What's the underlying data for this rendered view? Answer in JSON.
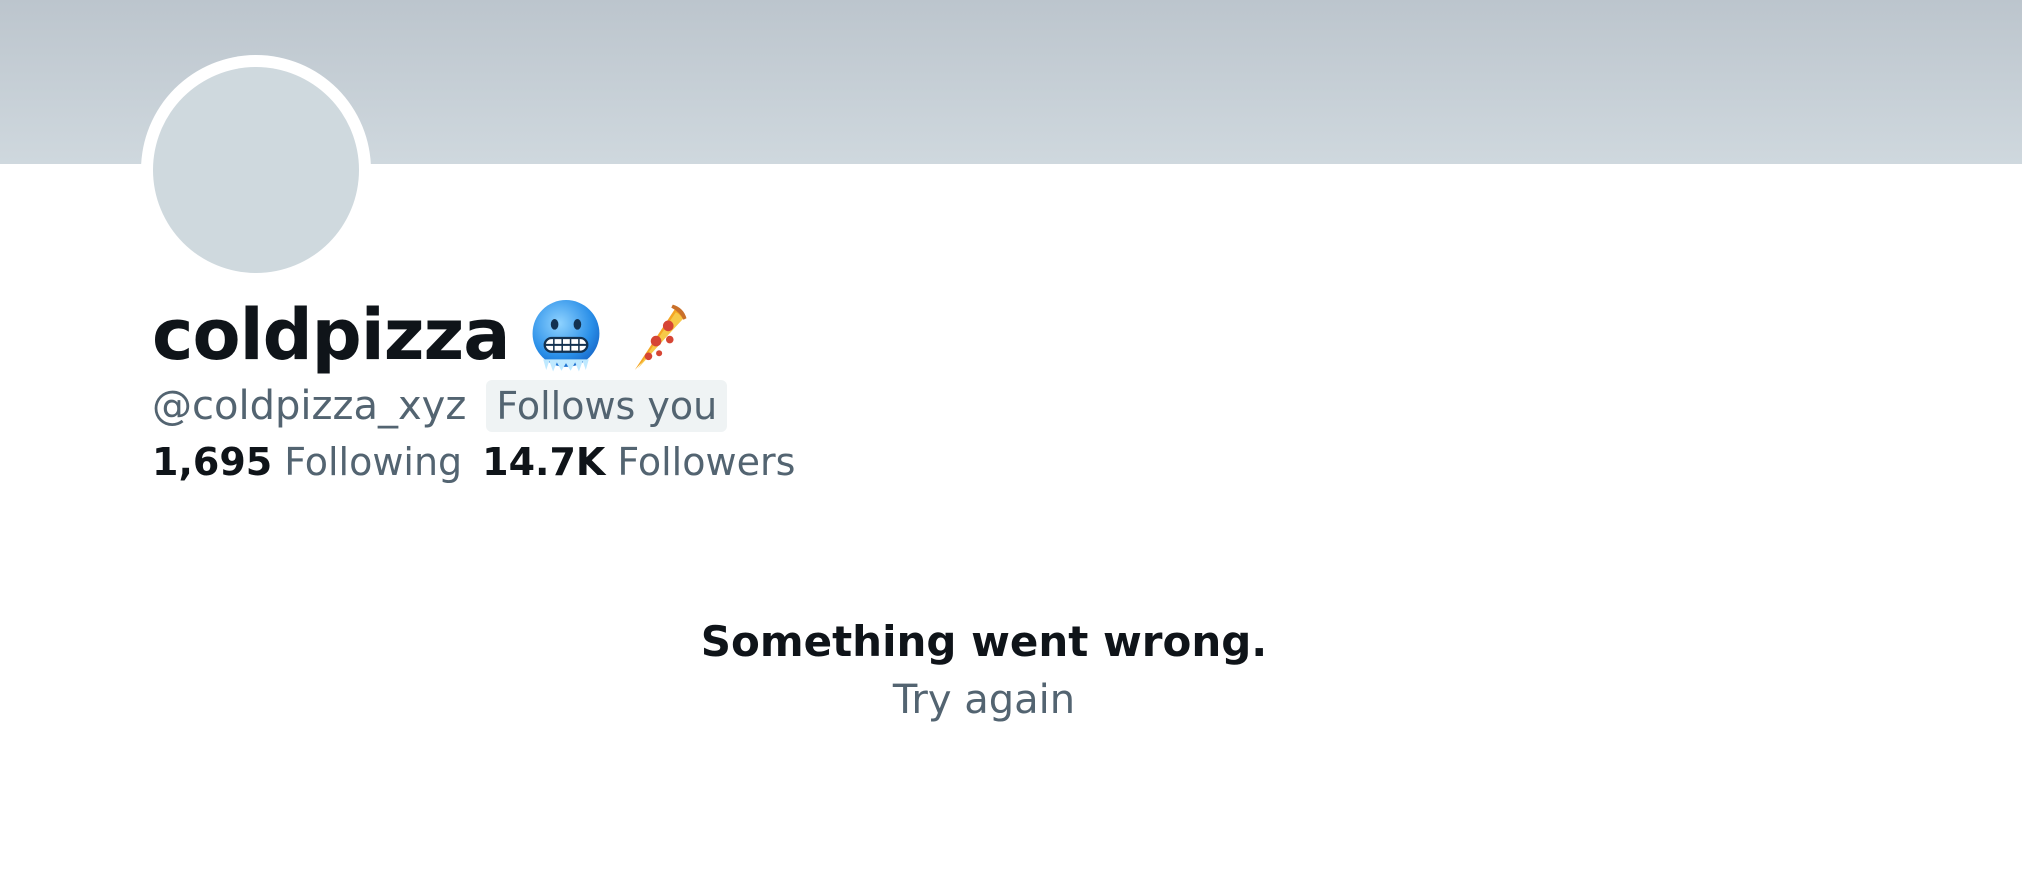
{
  "profile": {
    "display_name": "coldpizza",
    "name_emojis": [
      "cold-face-emoji",
      "pizza-slice-emoji"
    ],
    "handle": "@coldpizza_xyz",
    "follows_you_badge": "Follows you"
  },
  "stats": {
    "following_count": "1,695",
    "following_label": "Following",
    "followers_count": "14.7K",
    "followers_label": "Followers"
  },
  "error": {
    "title": "Something went wrong.",
    "retry_label": "Try again"
  },
  "colors": {
    "banner": "#cfd8de",
    "avatar_placeholder": "#cfd9de",
    "text_primary": "#0f1419",
    "text_secondary": "#536471",
    "badge_bg": "#eff3f4"
  }
}
